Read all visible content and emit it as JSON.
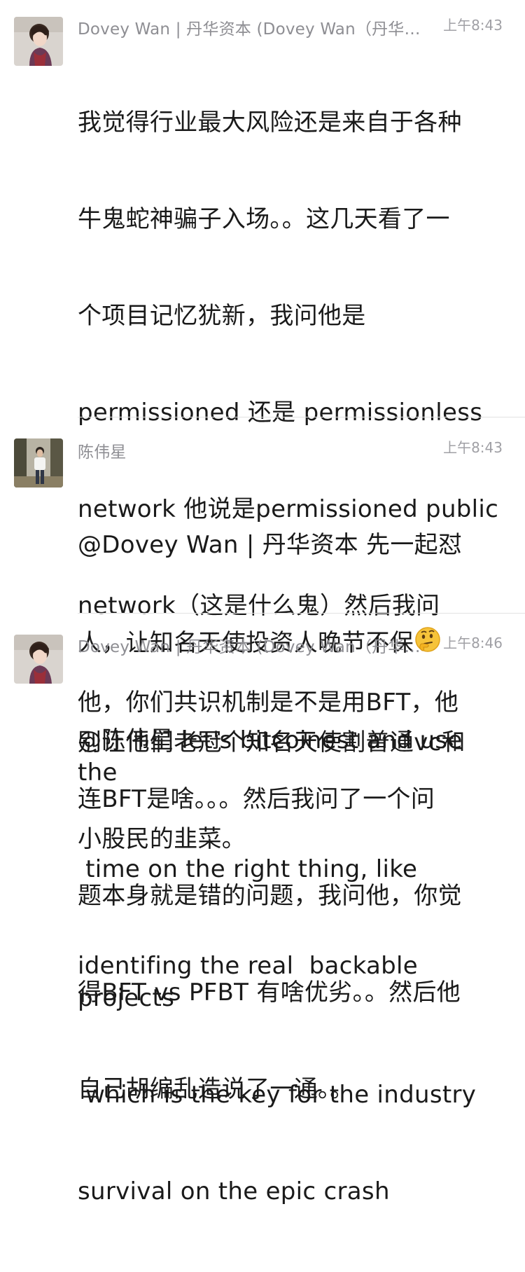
{
  "messages": [
    {
      "sender": "Dovey Wan | 丹华资本 (Dovey Wan（丹华资本 创始合伙人）)",
      "time": "上午8:43",
      "avatar": "woman-portrait-avatar",
      "lines": [
        "我觉得行业最大风险还是来自于各种",
        "牛鬼蛇神骗子入场。。这几天看了一",
        "个项目记忆犹新，我问他是",
        "permissioned 还是 permissionless",
        "network 他说是permissioned public",
        "network（这是什么鬼）然后我问",
        "他，你们共识机制是不是用BFT，他",
        "连BFT是啥。。。然后我问了一个问",
        "题本身就是错的问题，我问他，你觉",
        "得BFT vs PFBT 有啥优劣。。然后他",
        "自己胡编乱造说了一通。。"
      ]
    },
    {
      "sender": "陈伟星",
      "time": "上午8:43",
      "avatar": "man-standing-photo-avatar",
      "line1": "@Dovey Wan | 丹华资本 先一起怼",
      "line2": "人，让知名天使投资人晚节不保",
      "emoji": "thinking-face-emoji",
      "line3": "别让他们老冠个知名天使割普通vc和",
      "line4": "小股民的韭菜。"
    },
    {
      "sender": "Dovey Wan | 丹华资本 (Dovey Wan（丹华资本 创始合伙人）)",
      "time": "上午8:46",
      "avatar": "woman-portrait-avatar",
      "lines": [
        "@陈伟星 let's bitcoinest and use the",
        " time on the right thing, like",
        "identifing the real  backable projects",
        " which is the key for the industry",
        "survival on the epic crash"
      ]
    }
  ],
  "colors": {
    "text": "#1a1a1a",
    "meta": "#8e8e93",
    "divider": "#e2e2e2"
  }
}
